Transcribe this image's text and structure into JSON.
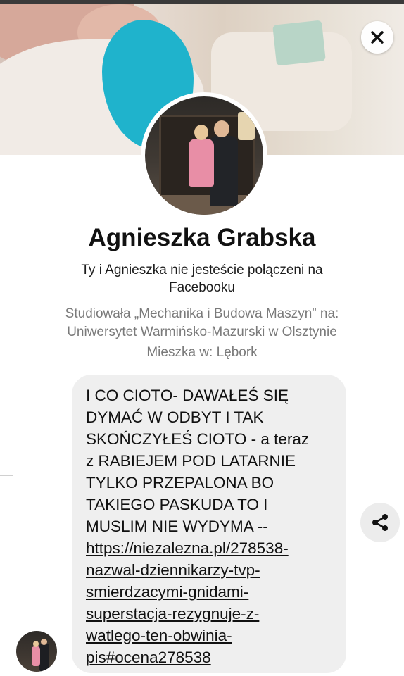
{
  "profile": {
    "name": "Agnieszka Grabska",
    "connection_status": "Ty i Agnieszka nie jesteście połączeni na Facebooku",
    "education": "Studiowała „Mechanika i Budowa Maszyn”  na: Uniwersytet Warmińsko-Mazurski w Olsztynie",
    "lives_in": "Mieszka w: Lębork"
  },
  "message": {
    "text": "I CO CIOTO- DAWAŁEŚ SIĘ\nDYMAĆ  W ODBYT I TAK\nSKOŃCZYŁEŚ CIOTO  - a teraz\nz RABIEJEM POD LATARNIE\nTYLKO PRZEPALONA BO\nTAKIEGO PASKUDA TO I\nMUSLIM NIE WYDYMA --",
    "link": "https://niezalezna.pl/278538-\nnazwal-dziennikarzy-tvp-\nsmierdzacymi-gnidami-\nsuperstacja-rezygnuje-z-\nwatlego-ten-obwinia-\npis#ocena278538"
  },
  "icons": {
    "close": "close-icon",
    "share": "share-icon"
  },
  "colors": {
    "bubble_bg": "#efefef",
    "cover_blur": "#1fb3cc",
    "secondary_text": "#7a7a7a"
  }
}
